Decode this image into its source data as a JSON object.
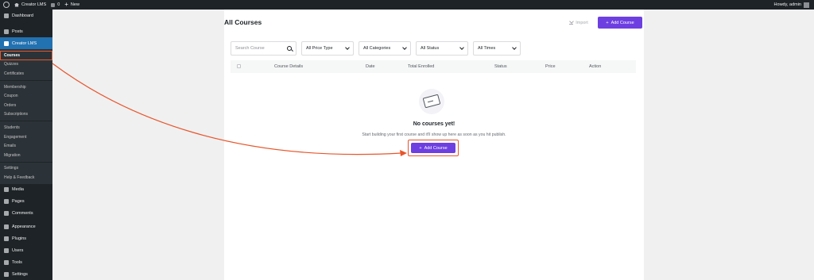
{
  "admin_bar": {
    "site_name": "Creator LMS",
    "comments_count": "0",
    "new_label": "New",
    "howdy": "Howdy, admin"
  },
  "sidebar": {
    "top_items": [
      {
        "label": "Dashboard",
        "icon": "dashboard-icon"
      },
      {
        "label": "Posts",
        "icon": "pin-icon"
      },
      {
        "label": "Creator LMS",
        "icon": "graduation-icon",
        "active": true
      }
    ],
    "submenu": {
      "group1": [
        "Courses",
        "Quizzes",
        "Certificates"
      ],
      "group2": [
        "Membership",
        "Coupon",
        "Orders",
        "Subscriptions"
      ],
      "group3": [
        "Students",
        "Engagement",
        "Emails",
        "Migration"
      ],
      "group4": [
        "Settings",
        "Help & Feedback"
      ],
      "current": "Courses"
    },
    "bottom_items": [
      {
        "label": "Media",
        "icon": "media-icon"
      },
      {
        "label": "Pages",
        "icon": "pages-icon"
      },
      {
        "label": "Comments",
        "icon": "comments-icon"
      },
      {
        "label": "Appearance",
        "icon": "brush-icon"
      },
      {
        "label": "Plugins",
        "icon": "plugin-icon"
      },
      {
        "label": "Users",
        "icon": "users-icon"
      },
      {
        "label": "Tools",
        "icon": "wrench-icon"
      },
      {
        "label": "Settings",
        "icon": "settings-icon"
      }
    ]
  },
  "page": {
    "title": "All Courses",
    "import_label": "Import",
    "add_course_label": "Add Course"
  },
  "filters": {
    "search_placeholder": "Search Course",
    "price_type": "All Price Type",
    "categories": "All Categories",
    "status": "All Status",
    "times": "All Times"
  },
  "table": {
    "columns": [
      "Course Details",
      "Date",
      "Total Enrolled",
      "Status",
      "Price",
      "Action"
    ]
  },
  "empty_state": {
    "title": "No courses yet!",
    "description": "Start building your first course and it'll show up here as soon as you hit publish.",
    "button_label": "Add Course"
  },
  "colors": {
    "accent": "#6d3fe0",
    "highlight": "#e8552a",
    "sidebar_bg": "#1d2327",
    "active_menu": "#2271b1"
  }
}
